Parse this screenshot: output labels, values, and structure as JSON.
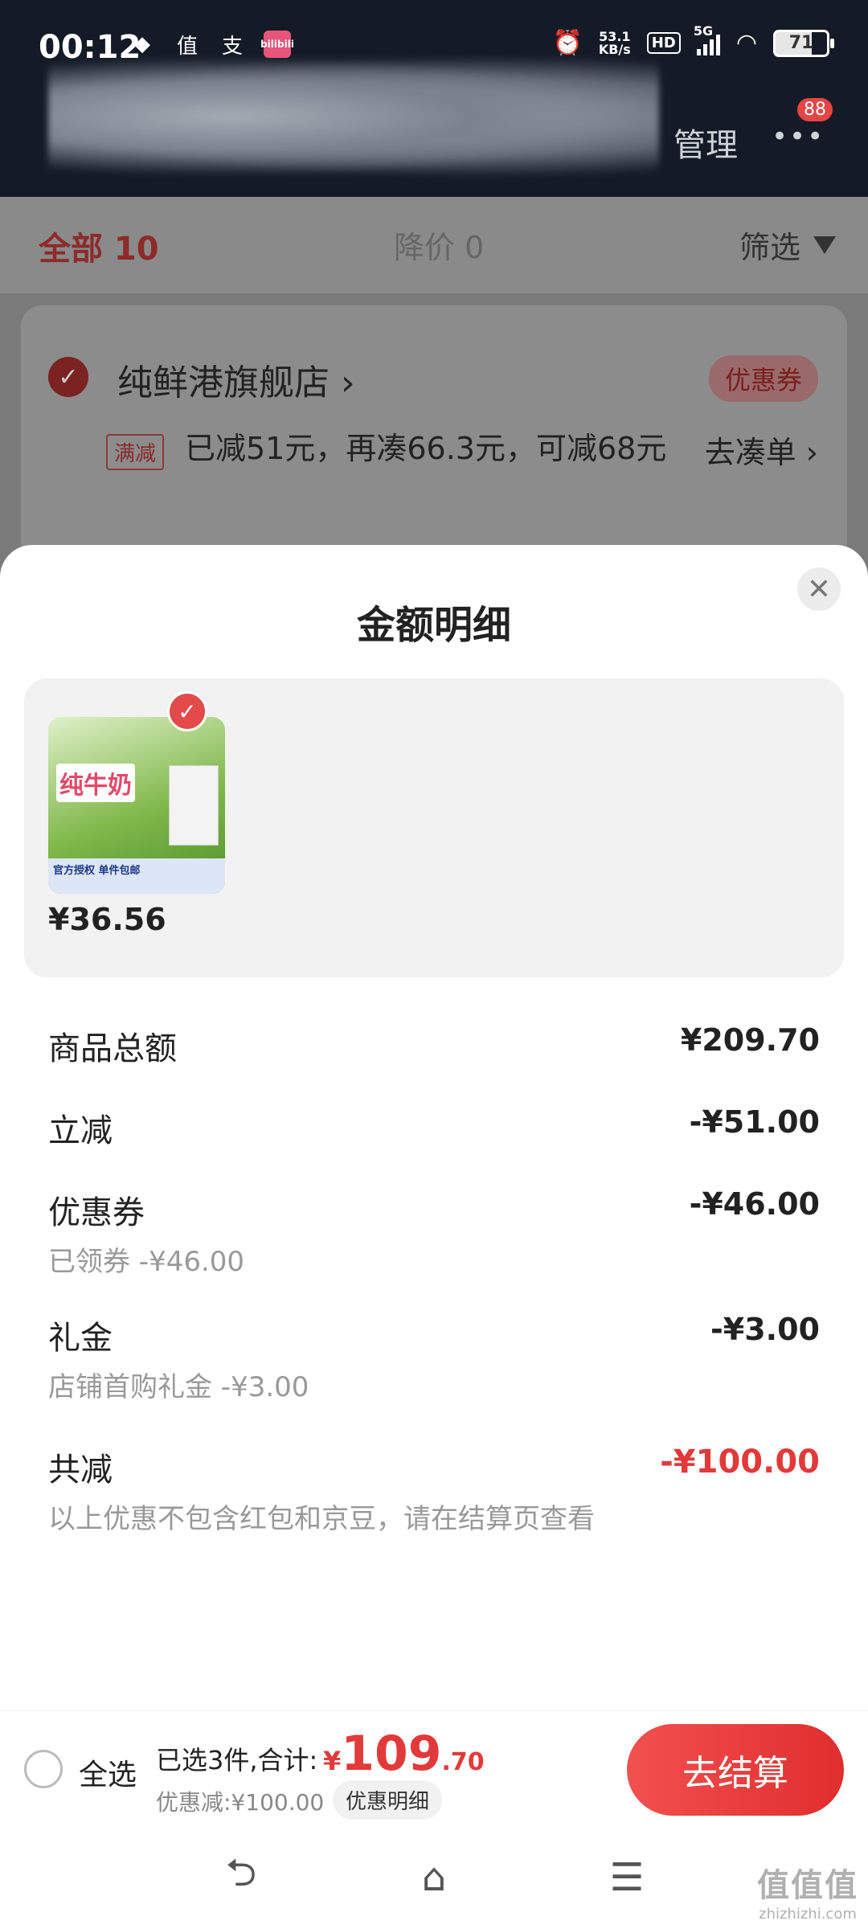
{
  "status_bar": {
    "time": "00:12",
    "net_speed_value": "53.1",
    "net_speed_unit": "KB/s",
    "hd_label": "HD",
    "network_label": "5G",
    "battery": "71",
    "notif_icons": [
      "qq-icon",
      "zhide-icon",
      "alipay-icon",
      "pink-app-icon"
    ],
    "notif_glyphs": [
      "◆",
      "值",
      "支",
      "bilibili"
    ]
  },
  "header": {
    "manage_label": "管理",
    "more_badge": "88"
  },
  "tabs": {
    "all_label": "全部 10",
    "price_drop_label": "降价 0",
    "filter_label": "筛选"
  },
  "store": {
    "name": "纯鲜港旗舰店 ›",
    "coupon_label": "优惠券",
    "promo_tag": "满减",
    "promo_text": "已减51元，再凑66.3元，可减68元",
    "goto_label": "去凑单 ›"
  },
  "sheet": {
    "title": "金额明细",
    "close_glyph": "✕",
    "product": {
      "price": "¥36.56",
      "thumb_text": "纯牛奶",
      "thumb_badge": "官方授权  单件包邮"
    },
    "rows": {
      "total": {
        "label": "商品总额",
        "value": "¥209.70"
      },
      "instant": {
        "label": "立减",
        "value": "-¥51.00"
      },
      "coupon": {
        "label": "优惠券",
        "value": "-¥46.00",
        "sub": "已领券 -¥46.00"
      },
      "gift": {
        "label": "礼金",
        "value": "-¥3.00",
        "sub": "店铺首购礼金 -¥3.00"
      },
      "sum": {
        "label": "共减",
        "value": "-¥100.00",
        "sub": "以上优惠不包含红包和京豆，请在结算页查看"
      }
    }
  },
  "checkout": {
    "select_all": "全选",
    "selected_text": "已选3件,合计:",
    "currency": "¥",
    "price_int": "109",
    "price_dec": ".70",
    "discount_text": "优惠减:¥100.00",
    "detail_label": "优惠明细",
    "pay_label": "去结算"
  },
  "navbar": {
    "back_glyph": "⮌",
    "home_glyph": "⌂",
    "menu_glyph": "☰"
  },
  "watermark": {
    "line1": "值值值",
    "line2": "zhizhizhi.com"
  },
  "colors": {
    "accent_red": "#e23a3a",
    "header_dark": "#141b26"
  }
}
